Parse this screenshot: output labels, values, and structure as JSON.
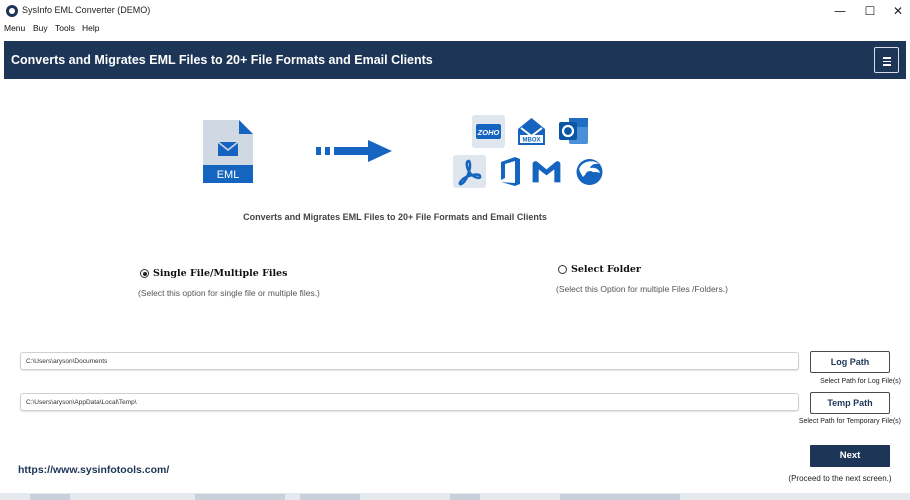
{
  "window": {
    "title": "SysInfo EML Converter (DEMO)",
    "controls": {
      "minimize": "—",
      "maximize": "☐",
      "close": "✕"
    }
  },
  "menu": [
    "Menu",
    "Buy",
    "Tools",
    "Help"
  ],
  "header": {
    "title": "Converts and Migrates EML Files to 20+ File Formats and Email Clients",
    "menu_icon": "hamburger-icon"
  },
  "illustration": {
    "source_label": "EML",
    "target_icons": [
      "zoho-icon",
      "mbox-icon",
      "outlook-icon",
      "pdf-icon",
      "office-icon",
      "gmail-icon",
      "thunderbird-icon"
    ],
    "zoho_text": "ZOHO",
    "mbox_text": "MBOX"
  },
  "caption": "Converts and Migrates EML Files to 20+ File Formats and Email Clients",
  "options": {
    "single": {
      "label": "Single File/Multiple Files",
      "description": "(Select this option for single file or multiple files.)",
      "selected": true
    },
    "folder": {
      "label": "Select Folder",
      "description": "(Select this Option for multiple Files /Folders.)",
      "selected": false
    }
  },
  "paths": {
    "log": {
      "value": "C:\\Users\\aryson\\Documents",
      "button": "Log Path",
      "hint": "Select Path for Log File(s)"
    },
    "temp": {
      "value": "C:\\Users\\aryson\\AppData\\Local\\Temp\\",
      "button": "Temp Path",
      "hint": "Select Path for Temporary File(s)"
    }
  },
  "footer": {
    "website": "https://www.sysinfotools.com/",
    "next_button": "Next",
    "next_hint": "(Proceed to the next screen.)"
  },
  "colors": {
    "brand": "#1d3557",
    "blue": "#1565c0",
    "pdf": "#1565c0"
  }
}
